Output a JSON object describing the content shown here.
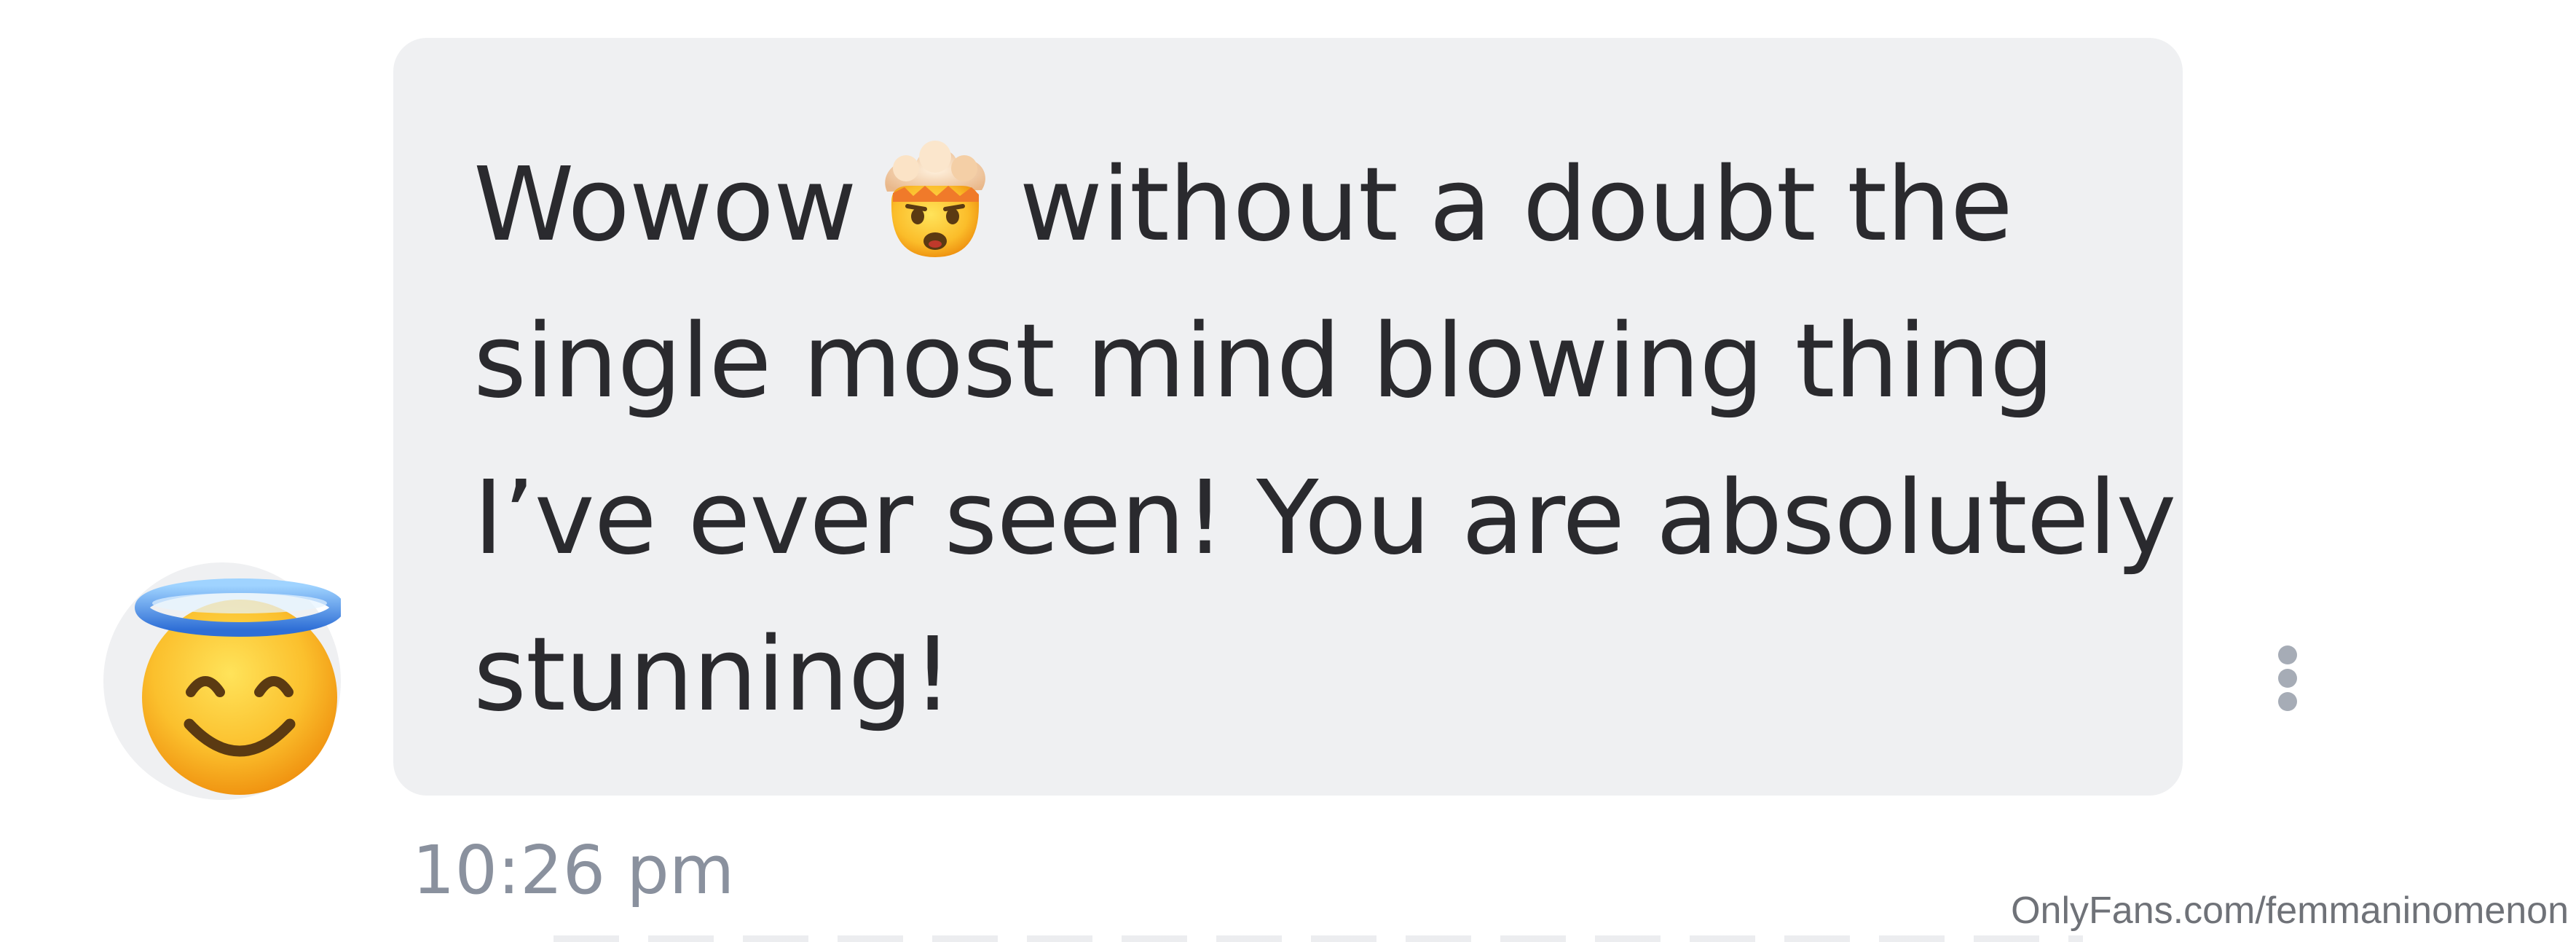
{
  "message": {
    "lines": [
      {
        "before": "Wowow",
        "emoji": "exploding-head-emoji",
        "after": "without a doubt the"
      },
      {
        "text": "single most mind blowing thing"
      },
      {
        "text": "I’ve ever seen! You are absolutely"
      },
      {
        "text": "stunning!"
      }
    ],
    "time": "10:26 pm"
  },
  "sender": {
    "avatar": "smiling-face-with-halo-emoji"
  },
  "actions": {
    "more_icon": "vertical-ellipsis-icon"
  },
  "watermark": "OnlyFans.com/femmaninomenon",
  "colors": {
    "bubble": "#eff0f2",
    "text": "#2a2a2e",
    "timestamp": "#8a919e",
    "more_dots": "#a6acb6"
  }
}
